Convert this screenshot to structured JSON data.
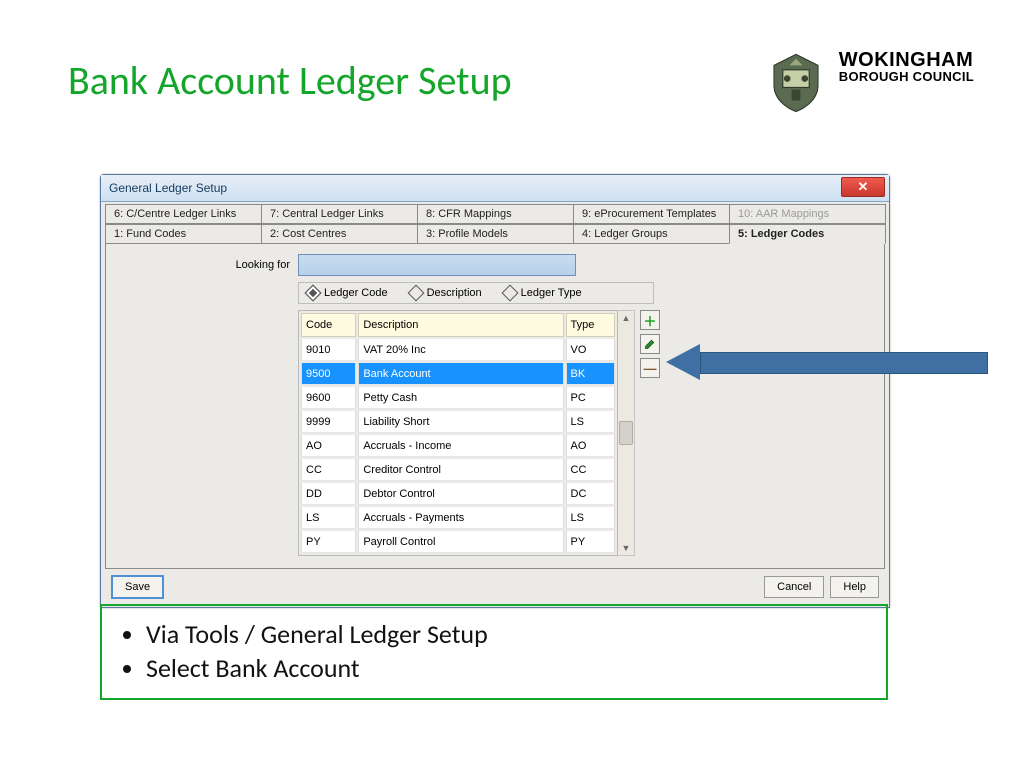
{
  "slide": {
    "title": "Bank Account Ledger Setup",
    "brand_top": "WOKINGHAM",
    "brand_bot": "BOROUGH COUNCIL"
  },
  "window": {
    "title": "General Ledger Setup",
    "tabs_row1": [
      {
        "label": "6: C/Centre Ledger Links"
      },
      {
        "label": "7: Central Ledger Links"
      },
      {
        "label": "8: CFR Mappings"
      },
      {
        "label": "9: eProcurement Templates"
      },
      {
        "label": "10: AAR Mappings",
        "disabled": true
      }
    ],
    "tabs_row2": [
      {
        "label": "1: Fund Codes"
      },
      {
        "label": "2: Cost Centres"
      },
      {
        "label": "3: Profile Models"
      },
      {
        "label": "4: Ledger Groups"
      },
      {
        "label": "5: Ledger Codes",
        "active": true
      }
    ],
    "looking_for_label": "Looking for",
    "filters": [
      {
        "label": "Ledger Code",
        "selected": true
      },
      {
        "label": "Description",
        "selected": false
      },
      {
        "label": "Ledger Type",
        "selected": false
      }
    ],
    "columns": {
      "code": "Code",
      "desc": "Description",
      "type": "Type"
    },
    "rows": [
      {
        "code": "9010",
        "desc": "VAT 20% Inc",
        "type": "VO"
      },
      {
        "code": "9500",
        "desc": "Bank Account",
        "type": "BK",
        "selected": true
      },
      {
        "code": "9600",
        "desc": "Petty Cash",
        "type": "PC"
      },
      {
        "code": "9999",
        "desc": "Liability Short",
        "type": "LS"
      },
      {
        "code": "AO",
        "desc": "Accruals - Income",
        "type": "AO"
      },
      {
        "code": "CC",
        "desc": "Creditor Control",
        "type": "CC"
      },
      {
        "code": "DD",
        "desc": "Debtor Control",
        "type": "DC"
      },
      {
        "code": "LS",
        "desc": "Accruals - Payments",
        "type": "LS"
      },
      {
        "code": "PY",
        "desc": "Payroll Control",
        "type": "PY"
      }
    ],
    "buttons": {
      "save": "Save",
      "cancel": "Cancel",
      "help": "Help"
    }
  },
  "bullets": [
    "Via Tools / General Ledger Setup",
    "Select Bank Account"
  ]
}
